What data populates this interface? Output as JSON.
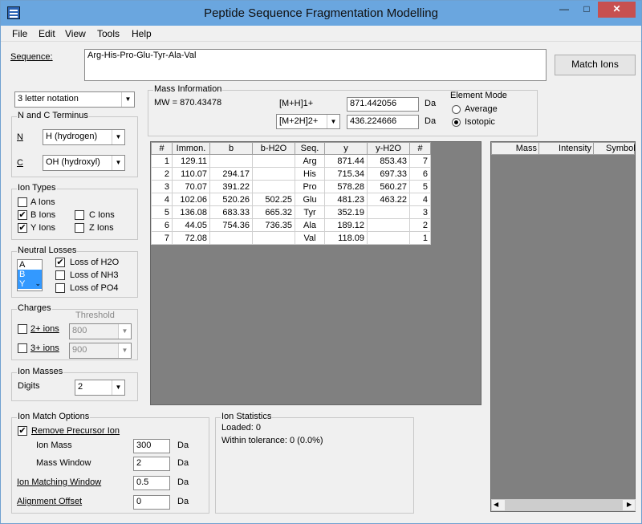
{
  "window": {
    "title": "Peptide Sequence Fragmentation Modelling",
    "controls": {
      "minimize": "—",
      "maximize": "□",
      "close": "✕"
    }
  },
  "menu": [
    "File",
    "Edit",
    "View",
    "Tools",
    "Help"
  ],
  "sequence": {
    "label": "Sequence:",
    "value": "Arg-His-Pro-Glu-Tyr-Ala-Val",
    "match_button": "Match Ions"
  },
  "notation": {
    "value": "3 letter notation"
  },
  "terminus": {
    "title": "N and C Terminus",
    "n_label": "N",
    "n_value": "H (hydrogen)",
    "c_label": "C",
    "c_value": "OH (hydroxyl)"
  },
  "ion_types": {
    "title": "Ion Types",
    "a": "A Ions",
    "b": "B Ions",
    "y": "Y Ions",
    "c": "C Ions",
    "z": "Z Ions",
    "b_checked": "✔",
    "y_checked": "✔"
  },
  "neutral_losses": {
    "title": "Neutral Losses",
    "list": [
      "A",
      "B",
      "Y"
    ],
    "h2o": "Loss of H2O",
    "nh3": "Loss of NH3",
    "po4": "Loss of PO4",
    "h2o_checked": "✔"
  },
  "charges": {
    "title": "Charges",
    "threshold": "Threshold",
    "two": "2+ ions",
    "two_value": "800",
    "three": "3+ ions",
    "three_value": "900"
  },
  "ion_masses": {
    "title": "Ion Masses",
    "digits_label": "Digits",
    "digits_value": "2"
  },
  "mass_info": {
    "title": "Mass Information",
    "mw": "MW = 870.43478",
    "mh1_label": "[M+H]1+",
    "mh1_value": "871.442056",
    "mh1_unit": "Da",
    "mh2_label": "[M+2H]2+",
    "mh2_value": "436.224666",
    "mh2_unit": "Da"
  },
  "element_mode": {
    "title": "Element Mode",
    "average": "Average",
    "isotopic": "Isotopic"
  },
  "fragment_table": {
    "headers": [
      "#",
      "Immon.",
      "b",
      "b-H2O",
      "Seq.",
      "y",
      "y-H2O",
      "#"
    ],
    "rows": [
      [
        "1",
        "129.11",
        "",
        "",
        "Arg",
        "871.44",
        "853.43",
        "7"
      ],
      [
        "2",
        "110.07",
        "294.17",
        "",
        "His",
        "715.34",
        "697.33",
        "6"
      ],
      [
        "3",
        "70.07",
        "391.22",
        "",
        "Pro",
        "578.28",
        "560.27",
        "5"
      ],
      [
        "4",
        "102.06",
        "520.26",
        "502.25",
        "Glu",
        "481.23",
        "463.22",
        "4"
      ],
      [
        "5",
        "136.08",
        "683.33",
        "665.32",
        "Tyr",
        "352.19",
        "",
        "3"
      ],
      [
        "6",
        "44.05",
        "754.36",
        "736.35",
        "Ala",
        "189.12",
        "",
        "2"
      ],
      [
        "7",
        "72.08",
        "",
        "",
        "Val",
        "118.09",
        "",
        "1"
      ]
    ]
  },
  "mass_grid": {
    "headers": [
      "Mass",
      "Intensity",
      "Symbol"
    ]
  },
  "ion_match": {
    "title": "Ion Match Options",
    "remove_precursor": "Remove Precursor Ion",
    "remove_checked": "✔",
    "ion_mass_label": "Ion Mass",
    "ion_mass_value": "300",
    "mass_window_label": "Mass Window",
    "mass_window_value": "2",
    "ion_window_label": "Ion Matching Window",
    "ion_window_value": "0.5",
    "offset_label": "Alignment Offset",
    "offset_value": "0",
    "unit": "Da"
  },
  "ion_stats": {
    "title": "Ion Statistics",
    "loaded": "Loaded: 0",
    "tolerance": "Within tolerance: 0 (0.0%)"
  },
  "scroll": {
    "left": "◀",
    "right": "▶",
    "down": "▼"
  }
}
